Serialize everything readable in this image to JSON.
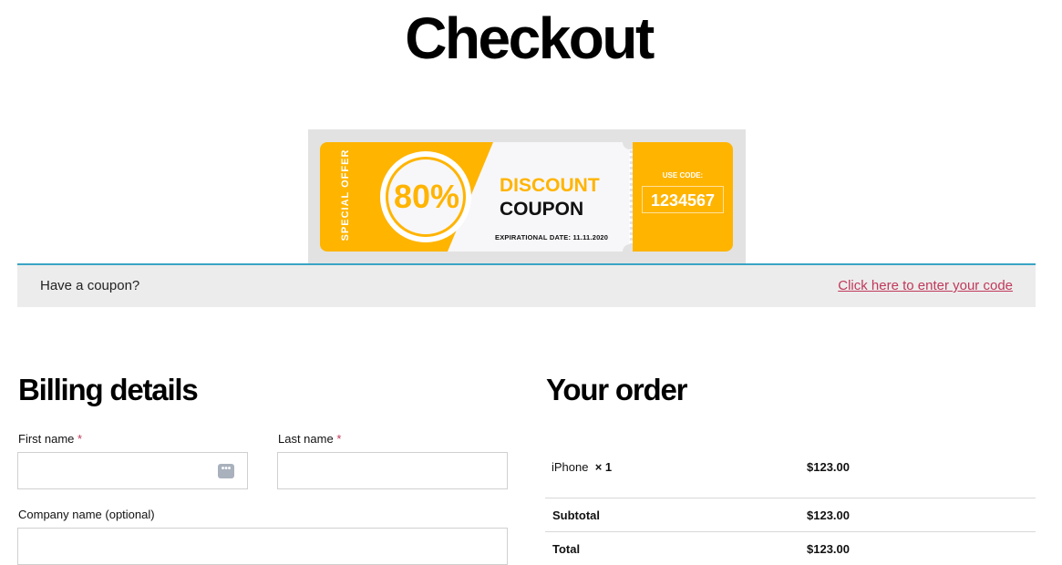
{
  "page": {
    "title": "Checkout"
  },
  "banner": {
    "special_offer": "SPECIAL OFFER",
    "percent": "80%",
    "discount": "DISCOUNT",
    "coupon": "COUPON",
    "expiration": "EXPIRATIONAL DATE: 11.11.2020",
    "use_code": "USE CODE:",
    "code": "1234567",
    "accent_color": "#ffb400"
  },
  "coupon_notice": {
    "text": "Have a coupon?",
    "link": "Click here to enter your code"
  },
  "billing": {
    "heading": "Billing details",
    "first_name_label": "First name",
    "last_name_label": "Last name",
    "company_label": "Company name (optional)",
    "required_mark": "*",
    "autofill_icon": "•••"
  },
  "order": {
    "heading": "Your order",
    "items": [
      {
        "name": "iPhone",
        "qty": "× 1",
        "price": "$123.00"
      }
    ],
    "subtotal_label": "Subtotal",
    "subtotal_value": "$123.00",
    "total_label": "Total",
    "total_value": "$123.00"
  }
}
